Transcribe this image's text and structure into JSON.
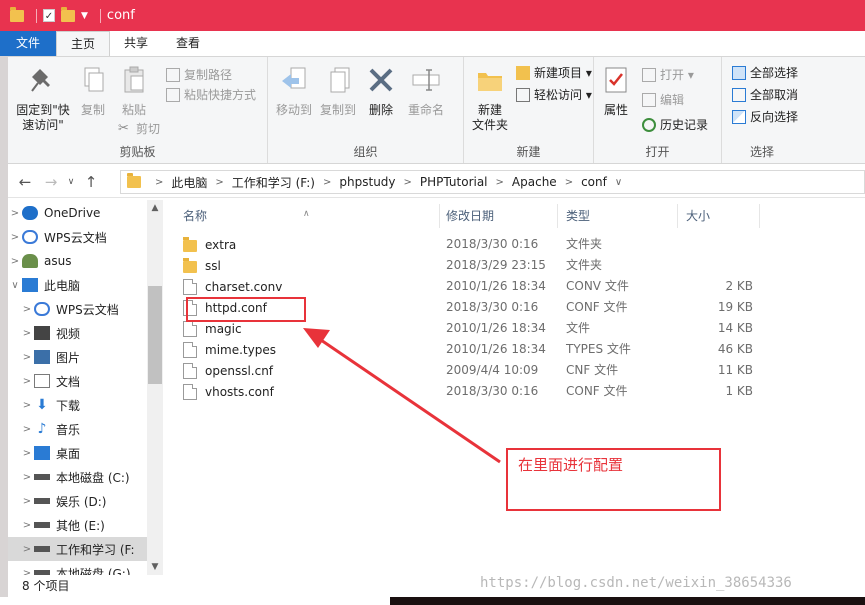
{
  "window": {
    "title": "conf"
  },
  "ribbon_tabs": [
    {
      "label": "文件"
    },
    {
      "label": "主页"
    },
    {
      "label": "共享"
    },
    {
      "label": "查看"
    }
  ],
  "ribbon": {
    "clipboard": {
      "label": "剪贴板",
      "pin_line1": "固定到\"快",
      "pin_line2": "速访问\"",
      "copy": "复制",
      "paste": "粘贴",
      "copy_path": "复制路径",
      "paste_shortcut": "粘贴快捷方式",
      "cut": "剪切"
    },
    "organize": {
      "label": "组织",
      "move_to": "移动到",
      "copy_to": "复制到",
      "delete": "删除",
      "rename": "重命名"
    },
    "new": {
      "label": "新建",
      "new_folder_line1": "新建",
      "new_folder_line2": "文件夹",
      "new_item": "新建项目 ▾",
      "easy_access": "轻松访问 ▾"
    },
    "open": {
      "label": "打开",
      "properties": "属性",
      "open": "打开 ▾",
      "edit": "编辑",
      "history": "历史记录"
    },
    "select": {
      "label": "选择",
      "select_all": "全部选择",
      "select_none": "全部取消",
      "invert": "反向选择"
    }
  },
  "address": {
    "crumbs": [
      "此电脑",
      "工作和学习 (F:)",
      "phpstudy",
      "PHPTutorial",
      "Apache",
      "conf"
    ]
  },
  "nav": [
    {
      "label": "OneDrive",
      "icon": "cloud-icon",
      "color": "#1e6fc9"
    },
    {
      "label": "WPS云文档",
      "icon": "cloud-icon",
      "color": "#3b7ad8"
    },
    {
      "label": "asus",
      "icon": "user-icon",
      "color": "#6a8f4a"
    },
    {
      "label": "此电脑",
      "icon": "computer-icon",
      "color": "#2a7bd4"
    },
    {
      "label": "WPS云文档",
      "icon": "cloud-icon",
      "color": "#3b7ad8"
    },
    {
      "label": "视频",
      "icon": "video-icon",
      "color": "#444444"
    },
    {
      "label": "图片",
      "icon": "picture-icon",
      "color": "#3b6fa8"
    },
    {
      "label": "文档",
      "icon": "document-icon",
      "color": "#7a7a7a"
    },
    {
      "label": "下载",
      "icon": "download-icon",
      "color": "#2a7bd4"
    },
    {
      "label": "音乐",
      "icon": "music-icon",
      "color": "#2a7bd4"
    },
    {
      "label": "桌面",
      "icon": "desktop-icon",
      "color": "#2a7bd4"
    },
    {
      "label": "本地磁盘 (C:)",
      "icon": "drive-icon",
      "color": "#555555"
    },
    {
      "label": "娱乐 (D:)",
      "icon": "drive-icon",
      "color": "#555555"
    },
    {
      "label": "其他 (E:)",
      "icon": "drive-icon",
      "color": "#555555"
    },
    {
      "label": "工作和学习 (F:",
      "icon": "drive-icon",
      "color": "#555555"
    },
    {
      "label": "本地磁盘 (G:)",
      "icon": "drive-icon",
      "color": "#555555"
    }
  ],
  "columns": {
    "name": "名称",
    "date": "修改日期",
    "type": "类型",
    "size": "大小"
  },
  "files": [
    {
      "name": "extra",
      "date": "2018/3/30 0:16",
      "type": "文件夹",
      "size": "",
      "kind": "folder"
    },
    {
      "name": "ssl",
      "date": "2018/3/29 23:15",
      "type": "文件夹",
      "size": "",
      "kind": "folder"
    },
    {
      "name": "charset.conv",
      "date": "2010/1/26 18:34",
      "type": "CONV 文件",
      "size": "2 KB",
      "kind": "file"
    },
    {
      "name": "httpd.conf",
      "date": "2018/3/30 0:16",
      "type": "CONF 文件",
      "size": "19 KB",
      "kind": "file"
    },
    {
      "name": "magic",
      "date": "2010/1/26 18:34",
      "type": "文件",
      "size": "14 KB",
      "kind": "file"
    },
    {
      "name": "mime.types",
      "date": "2010/1/26 18:34",
      "type": "TYPES 文件",
      "size": "46 KB",
      "kind": "file"
    },
    {
      "name": "openssl.cnf",
      "date": "2009/4/4 10:09",
      "type": "CNF 文件",
      "size": "11 KB",
      "kind": "file"
    },
    {
      "name": "vhosts.conf",
      "date": "2018/3/30 0:16",
      "type": "CONF 文件",
      "size": "1 KB",
      "kind": "file"
    }
  ],
  "status": {
    "item_count": "8 个项目"
  },
  "annotation": {
    "note": "在里面进行配置"
  },
  "watermark": "https://blog.csdn.net/weixin_38654336",
  "colors": {
    "titlebar": "#e8334f",
    "file_tab": "#1e6fc9",
    "annotation": "#e8333a"
  }
}
